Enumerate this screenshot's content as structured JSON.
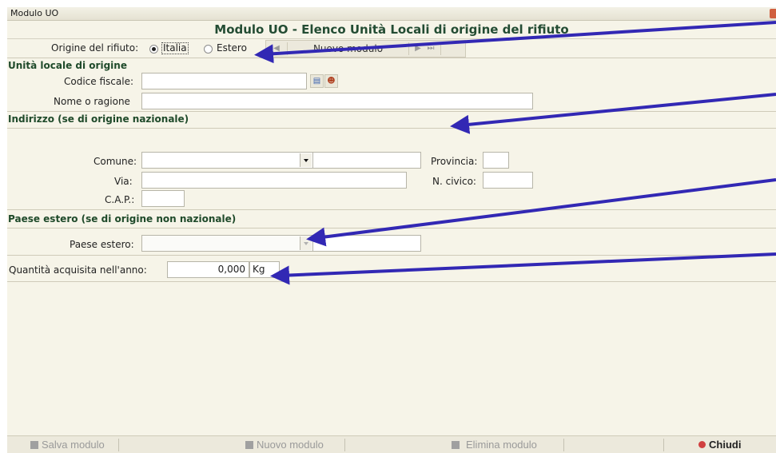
{
  "window": {
    "title": "Modulo UO"
  },
  "form": {
    "title": "Modulo UO - Elenco Unità Locali di origine del rifiuto"
  },
  "origin": {
    "label": "Origine del rifiuto:",
    "option_italia": "Italia",
    "option_estero": "Estero",
    "selected": "Italia"
  },
  "nav": {
    "new_label": "Nuovo modulo"
  },
  "unita": {
    "header": "Unità locale di origine",
    "cf_label": "Codice fiscale:",
    "cf_value": "",
    "nome_label": "Nome o ragione",
    "nome_value": ""
  },
  "indirizzo": {
    "header": "Indirizzo (se di origine nazionale)",
    "comune_label": "Comune:",
    "comune_value": "",
    "provincia_label": "Provincia:",
    "provincia_value": "",
    "via_label": "Via:",
    "via_value": "",
    "civico_label": "N. civico:",
    "civico_value": "",
    "cap_label": "C.A.P.:",
    "cap_value": ""
  },
  "estero": {
    "header": "Paese estero (se di origine non nazionale)",
    "paese_label": "Paese estero:",
    "paese_value": ""
  },
  "quantita": {
    "label": "Quantità acquisita nell'anno:",
    "value": "0,000",
    "unit": "Kg"
  },
  "footer": {
    "save": "Salva modulo",
    "new": "Nuovo modulo",
    "delete": "Elimina modulo",
    "close": "Chiudi"
  },
  "colors": {
    "arrow": "#3228b4",
    "header_green": "#1f4a2a",
    "close_red": "#d04040"
  }
}
